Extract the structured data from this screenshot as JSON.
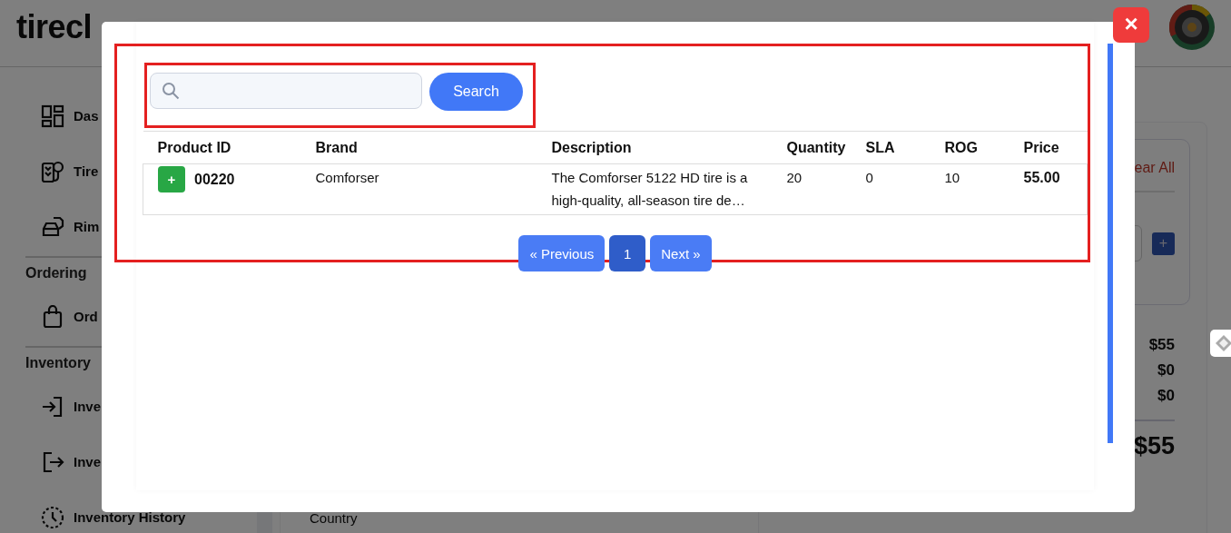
{
  "background": {
    "logo": "tirecl",
    "sidebar": [
      {
        "kind": "item",
        "label": "Das"
      },
      {
        "kind": "item",
        "label": "Tire"
      },
      {
        "kind": "item",
        "label": "Rim"
      },
      {
        "kind": "section",
        "label": "Ordering"
      },
      {
        "kind": "item",
        "label": "Ord"
      },
      {
        "kind": "section",
        "label": "Inventory"
      },
      {
        "kind": "item",
        "label": "Inve"
      },
      {
        "kind": "item",
        "label": "Inve"
      },
      {
        "kind": "item",
        "label": "Inventory History"
      }
    ],
    "main": {
      "field_label": "Country"
    },
    "cart": {
      "clear_link": "ear All",
      "add_button": "+",
      "lines": [
        "$55",
        "$0",
        "$0"
      ],
      "total": "$55"
    }
  },
  "modal": {
    "close": "×",
    "search": {
      "button": "Search"
    },
    "table": {
      "columns": [
        "Product ID",
        "Brand",
        "Description",
        "Quantity",
        "SLA",
        "ROG",
        "Price"
      ],
      "rows": [
        {
          "add": "+",
          "product_id": "00220",
          "brand": "Comforser",
          "description": "The Comforser 5122 HD tire is a high-quality, all-season tire de…",
          "quantity": "20",
          "sla": "0",
          "rog": "10",
          "price": "55.00"
        }
      ]
    },
    "pagination": {
      "previous": "« Previous",
      "pages": [
        {
          "label": "1",
          "selected": true
        }
      ],
      "next": "Next »"
    }
  }
}
